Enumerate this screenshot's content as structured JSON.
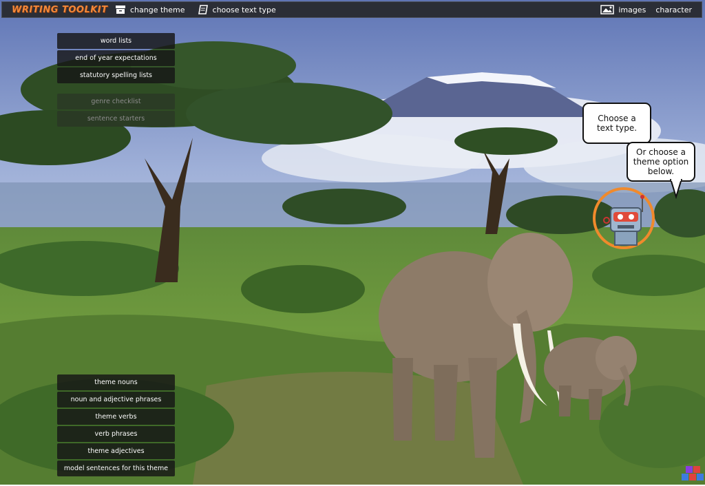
{
  "app": {
    "logo_text": "WRITING TOOLKIT"
  },
  "toolbar": {
    "change_theme_label": "change theme",
    "choose_text_type_label": "choose text type",
    "images_label": "images",
    "character_label": "character"
  },
  "top_menu": {
    "items": [
      {
        "label": "word lists",
        "enabled": true
      },
      {
        "label": "end of year expectations",
        "enabled": true
      },
      {
        "label": "statutory spelling lists",
        "enabled": true
      },
      {
        "label": "genre checklist",
        "enabled": false
      },
      {
        "label": "sentence starters",
        "enabled": false
      }
    ]
  },
  "theme_menu": {
    "items": [
      {
        "label": "theme nouns"
      },
      {
        "label": "noun and adjective phrases"
      },
      {
        "label": "theme verbs"
      },
      {
        "label": "verb phrases"
      },
      {
        "label": "theme adjectives"
      },
      {
        "label": "model sentences for this theme"
      }
    ]
  },
  "character": {
    "bubble_1": "Choose a text type.",
    "bubble_2": "Or choose a theme option below."
  },
  "colors": {
    "toolbar_bg": "#2b2e36",
    "logo": "#f2883a",
    "robot_ring": "#f08a2c"
  }
}
